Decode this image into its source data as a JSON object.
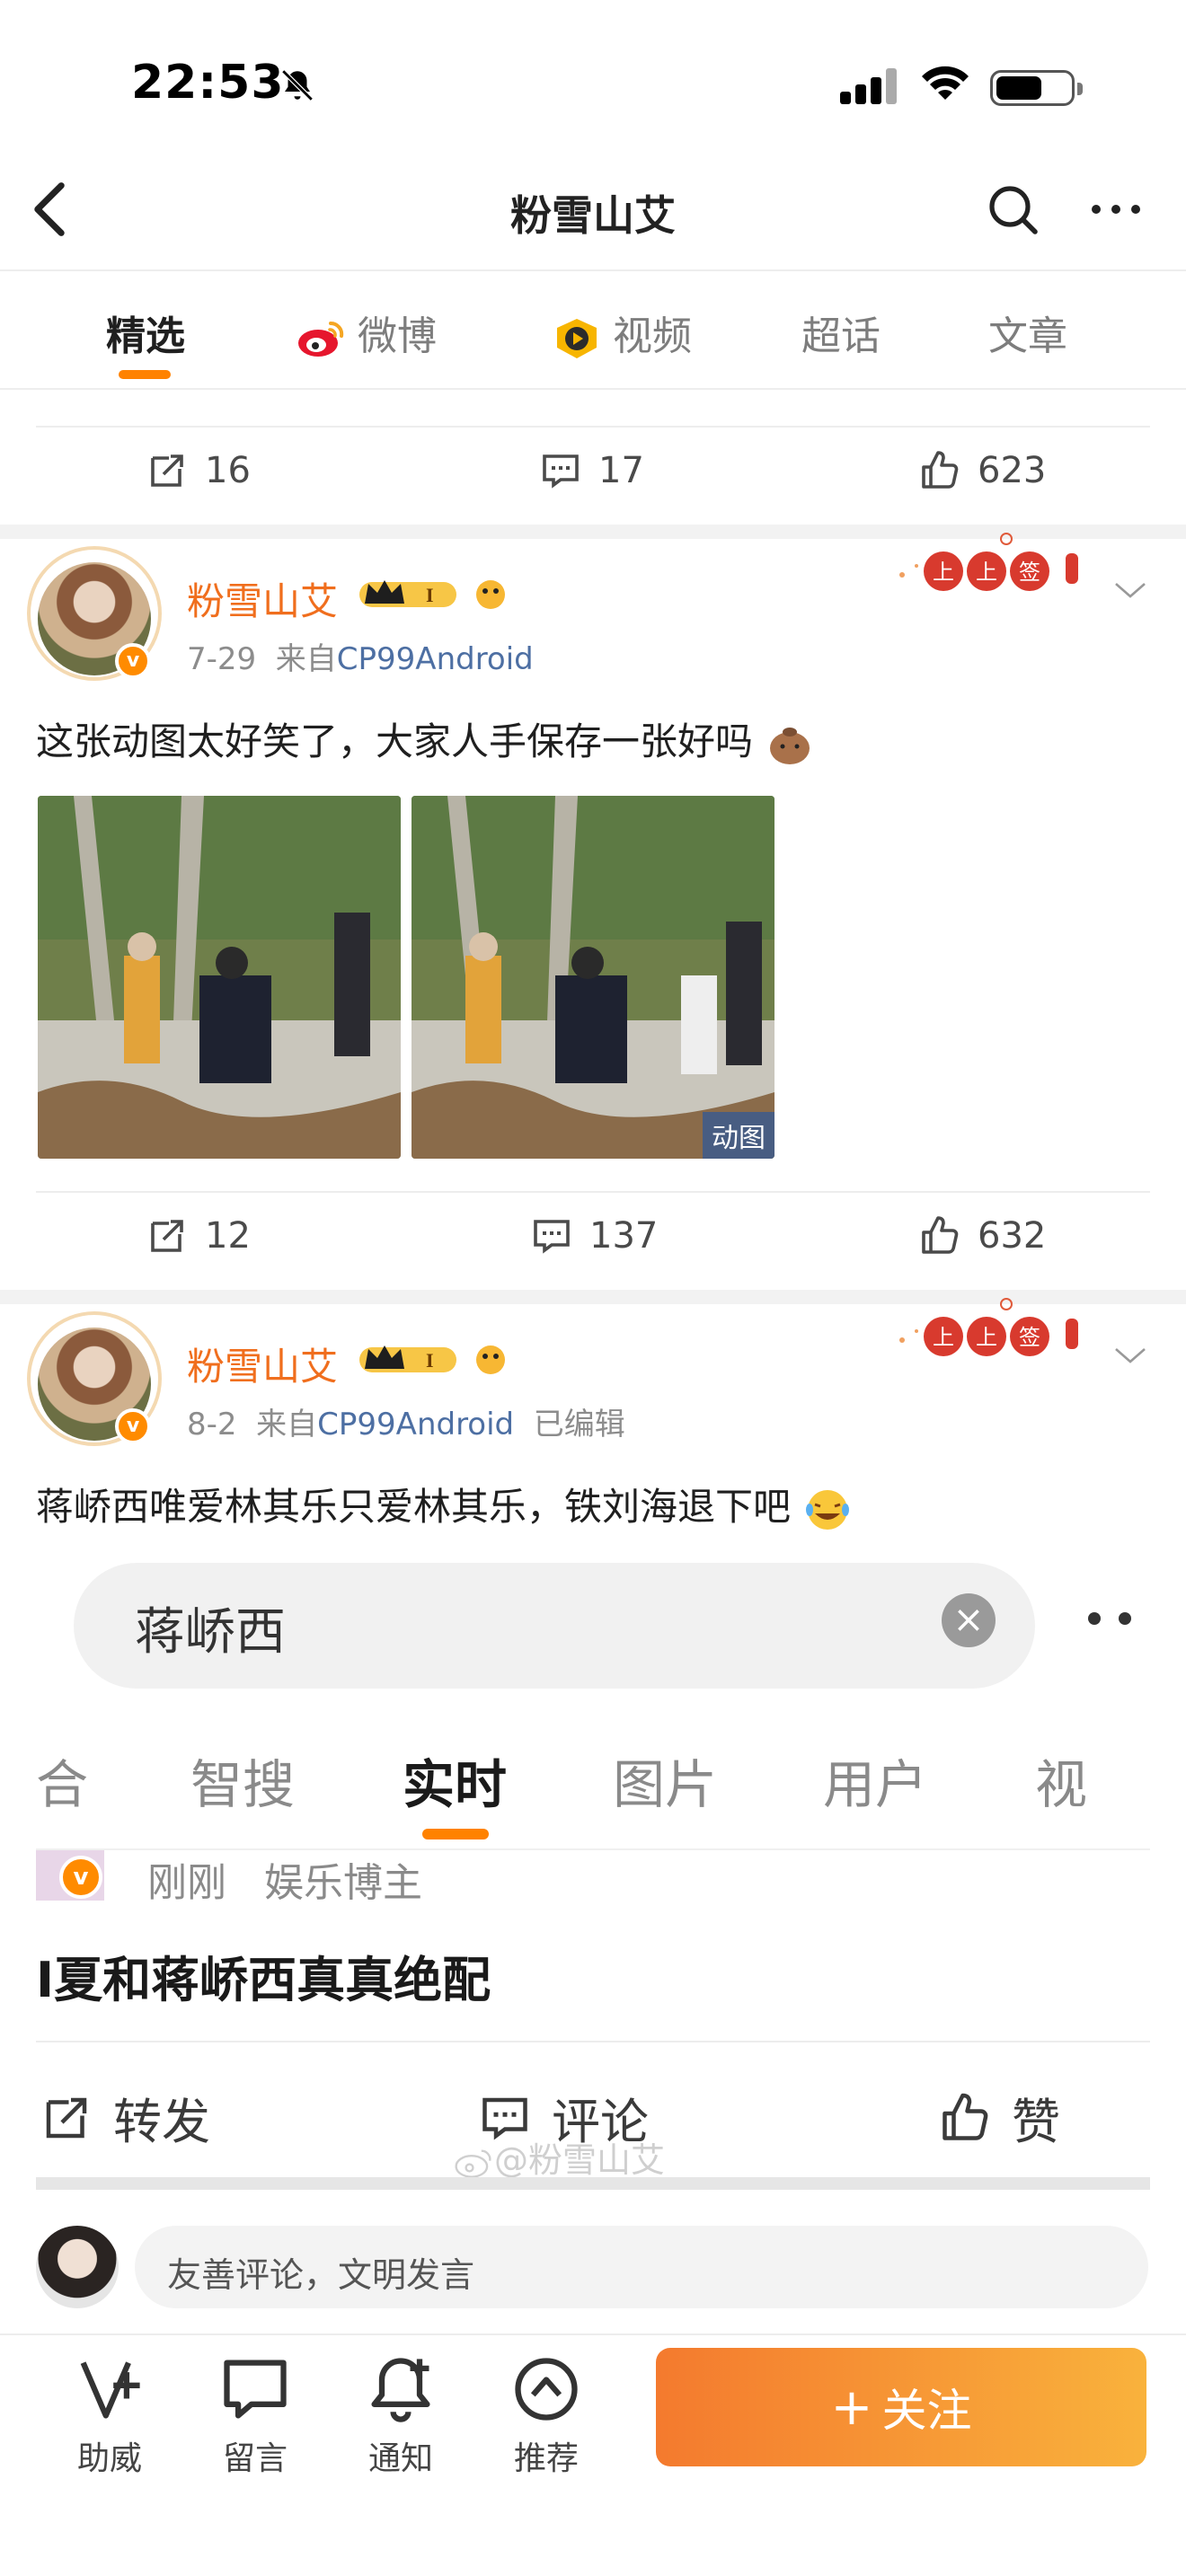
{
  "status_bar": {
    "time": "22:53"
  },
  "nav": {
    "title": "粉雪山艾"
  },
  "tabs": [
    {
      "label": "精选",
      "active": true
    },
    {
      "label": "微博",
      "active": false
    },
    {
      "label": "视频",
      "active": false
    },
    {
      "label": "超话",
      "active": false
    },
    {
      "label": "文章",
      "active": false
    }
  ],
  "prev_post_actions": {
    "reposts": "16",
    "comments": "17",
    "likes": "623"
  },
  "posts": [
    {
      "username": "粉雪山艾",
      "date": "7-29",
      "source_prefix": "来自",
      "source": "CP99Android",
      "edited": "",
      "text": "这张动图太好笑了，大家人手保存一张好吗",
      "gif_label": "动图",
      "reposts": "12",
      "comments": "137",
      "likes": "632"
    },
    {
      "username": "粉雪山艾",
      "date": "8-2",
      "source_prefix": "来自",
      "source": "CP99Android",
      "edited": "已编辑",
      "text": "蒋峤西唯爱林其乐只爱林其乐，铁刘海退下吧"
    }
  ],
  "embedded": {
    "search_text": "蒋峤西",
    "tabs": [
      "合",
      "智搜",
      "实时",
      "图片",
      "用户",
      "视"
    ],
    "active_tab": "实时",
    "meta_time": "刚刚",
    "meta_role": "娱乐博主",
    "post_text": "I夏和蒋峤西真真绝配",
    "actions": {
      "repost": "转发",
      "comment": "评论",
      "like": "赞"
    },
    "watermark": "@粉雪山艾"
  },
  "comment_bar": {
    "placeholder": "友善评论，文明发言"
  },
  "bottom_bar": {
    "items": [
      {
        "label": "助威",
        "icon": "cheer-icon"
      },
      {
        "label": "留言",
        "icon": "message-icon"
      },
      {
        "label": "通知",
        "icon": "bell-plus-icon"
      },
      {
        "label": "推荐",
        "icon": "recommend-icon"
      }
    ],
    "follow_label": "关注"
  },
  "colors": {
    "accent": "#ff8200",
    "username": "#f06e1d",
    "source_link": "#4d6fa3"
  }
}
